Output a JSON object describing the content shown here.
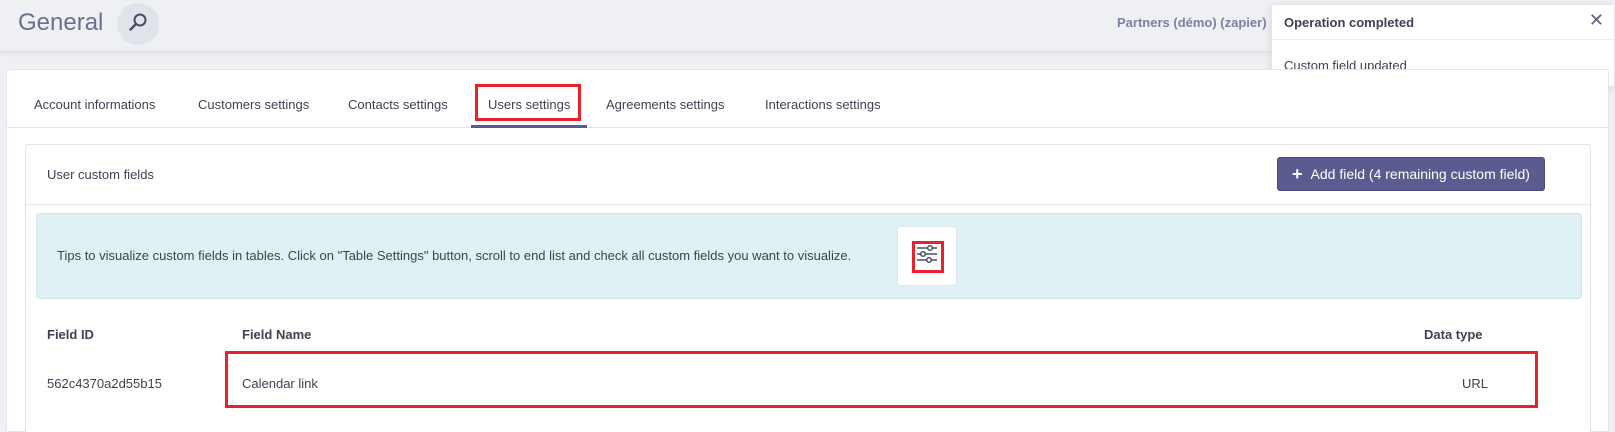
{
  "header": {
    "title": "General",
    "account_name": "Partners (démo) (zapier)"
  },
  "toast": {
    "title": "Operation completed",
    "message": "Custom field updated",
    "close": "✕"
  },
  "tabs": [
    {
      "label": "Account informations"
    },
    {
      "label": "Customers settings"
    },
    {
      "label": "Contacts settings"
    },
    {
      "label": "Users settings",
      "active": true
    },
    {
      "label": "Agreements settings"
    },
    {
      "label": "Interactions settings"
    }
  ],
  "panel": {
    "title": "User custom fields",
    "add_button": "Add field (4 remaining custom field)",
    "tips": "Tips to visualize custom fields in tables. Click on \"Table Settings\" button, scroll to end list and check all custom fields you want to visualize."
  },
  "table": {
    "columns": [
      "Field ID",
      "Field Name",
      "Data type"
    ],
    "rows": [
      [
        "562c4370a2d55b15",
        "Calendar link",
        "URL"
      ]
    ]
  },
  "colors": {
    "accent": "#5b5b8f",
    "highlight": "#e8212e",
    "tips_bg": "#dff1f5"
  },
  "icons": {
    "search": "search-icon",
    "close": "close-icon",
    "plus": "plus-icon",
    "table_settings": "sliders-icon"
  }
}
